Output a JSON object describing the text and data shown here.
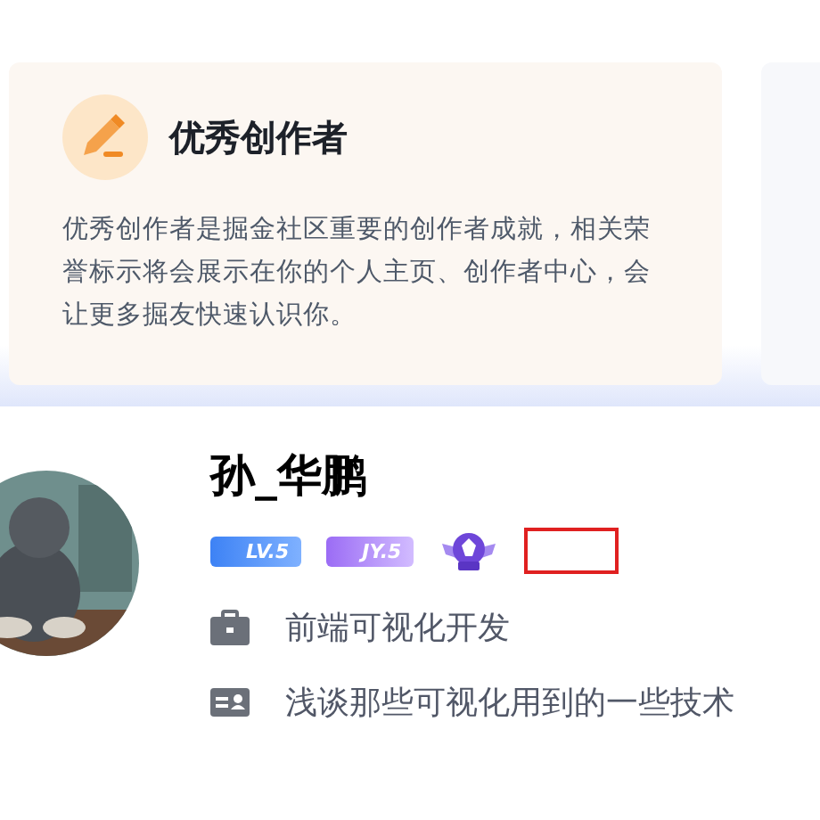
{
  "cards": [
    {
      "kind": "info",
      "title": "优秀创作者",
      "text": "优秀创作者是掘金社区重要的创作者成就，相关荣誉标示将会展示在你的个人主页、创作者中心，会让更多掘友快速认识你。"
    },
    {
      "kind": "blank"
    }
  ],
  "profile": {
    "name": "孙_华鹏",
    "badges": [
      {
        "kind": "level",
        "label": "LV.5"
      },
      {
        "kind": "juejin",
        "label": "JY.5"
      },
      {
        "kind": "medal"
      },
      {
        "kind": "highlight"
      }
    ],
    "job": "前端可视化开发",
    "bio": "浅谈那些可视化用到的一些技术"
  }
}
